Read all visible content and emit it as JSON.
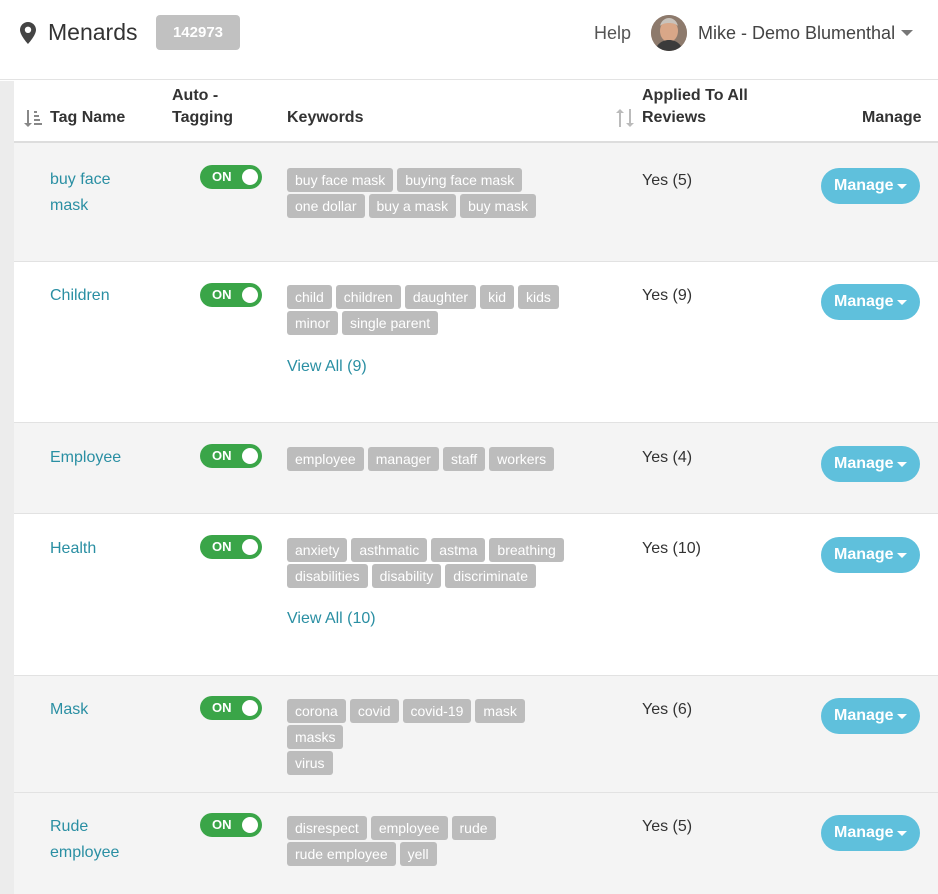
{
  "header": {
    "brand": "Menards",
    "badge": "142973",
    "help": "Help",
    "user": "Mike - Demo Blumenthal"
  },
  "table": {
    "columns": {
      "tag_name": "Tag Name",
      "auto_line1": "Auto -",
      "auto_line2": "Tagging",
      "keywords": "Keywords",
      "applied_line1": "Applied To All",
      "applied_line2": "Reviews",
      "manage": "Manage"
    },
    "rows": [
      {
        "name_l1": "buy face",
        "name_l2": "mask",
        "toggle": "ON",
        "keywords": [
          "buy face mask",
          "buying face mask",
          "one dollar",
          "buy a mask",
          "buy mask"
        ],
        "view_all": "",
        "applied": "Yes (5)",
        "manage": "Manage"
      },
      {
        "name_l1": "Children",
        "name_l2": "",
        "toggle": "ON",
        "keywords": [
          "child",
          "children",
          "daughter",
          "kid",
          "kids",
          "minor",
          "single parent"
        ],
        "view_all": "View All (9)",
        "applied": "Yes (9)",
        "manage": "Manage"
      },
      {
        "name_l1": "Employee",
        "name_l2": "",
        "toggle": "ON",
        "keywords": [
          "employee",
          "manager",
          "staff",
          "workers"
        ],
        "view_all": "",
        "applied": "Yes (4)",
        "manage": "Manage"
      },
      {
        "name_l1": "Health",
        "name_l2": "",
        "toggle": "ON",
        "keywords": [
          "anxiety",
          "asthmatic",
          "astma",
          "breathing",
          "disabilities",
          "disability",
          "discriminate"
        ],
        "view_all": "View All (10)",
        "applied": "Yes (10)",
        "manage": "Manage"
      },
      {
        "name_l1": "Mask",
        "name_l2": "",
        "toggle": "ON",
        "keywords": [
          "corona",
          "covid",
          "covid-19",
          "mask",
          "masks",
          "virus"
        ],
        "view_all": "",
        "applied": "Yes (6)",
        "manage": "Manage"
      },
      {
        "name_l1": "Rude",
        "name_l2": "employee",
        "toggle": "ON",
        "keywords": [
          "disrespect",
          "employee",
          "rude",
          "rude employee",
          "yell"
        ],
        "view_all": "",
        "applied": "Yes (5)",
        "manage": "Manage"
      }
    ]
  },
  "colors": {
    "link": "#2a8fa3",
    "toggle_on": "#3aa548",
    "manage_button": "#5fc0dc",
    "keyword_chip": "#bcbcbc"
  },
  "icons": [
    "location-pin-icon",
    "sort-amount-icon",
    "sort-icon",
    "chevron-down-icon"
  ]
}
